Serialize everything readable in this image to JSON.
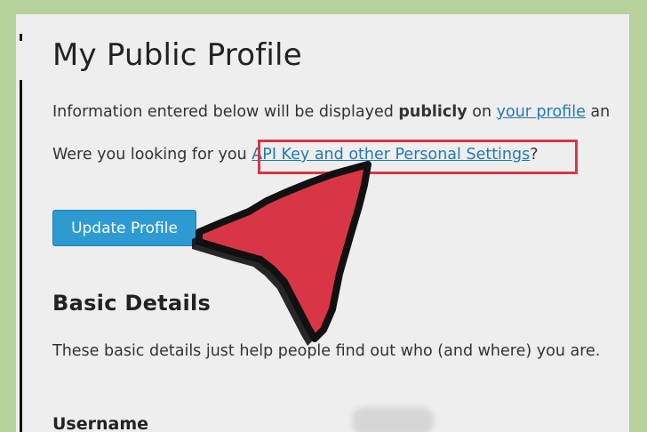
{
  "page": {
    "title": "My Public Profile"
  },
  "intro": {
    "text_before": "Information entered below will be displayed ",
    "text_bold": "publicly",
    "text_after": " on ",
    "profile_link": "your profile",
    "text_tail": " an"
  },
  "settings_prompt": {
    "text_before": "Were you looking for you",
    "link_label": "API Key and other Personal Settings",
    "text_after": "?"
  },
  "actions": {
    "update_label": "Update Profile"
  },
  "basic_details": {
    "heading": "Basic Details",
    "description": "These basic details just help people find out who (and where) you are."
  },
  "fields": {
    "username_label": "Username"
  },
  "colors": {
    "arrow": "#d83646",
    "highlight": "#d83646",
    "link": "#2379b4",
    "button": "#2d9bd1"
  },
  "icons": {
    "pointer": "arrow-pointer-icon"
  }
}
